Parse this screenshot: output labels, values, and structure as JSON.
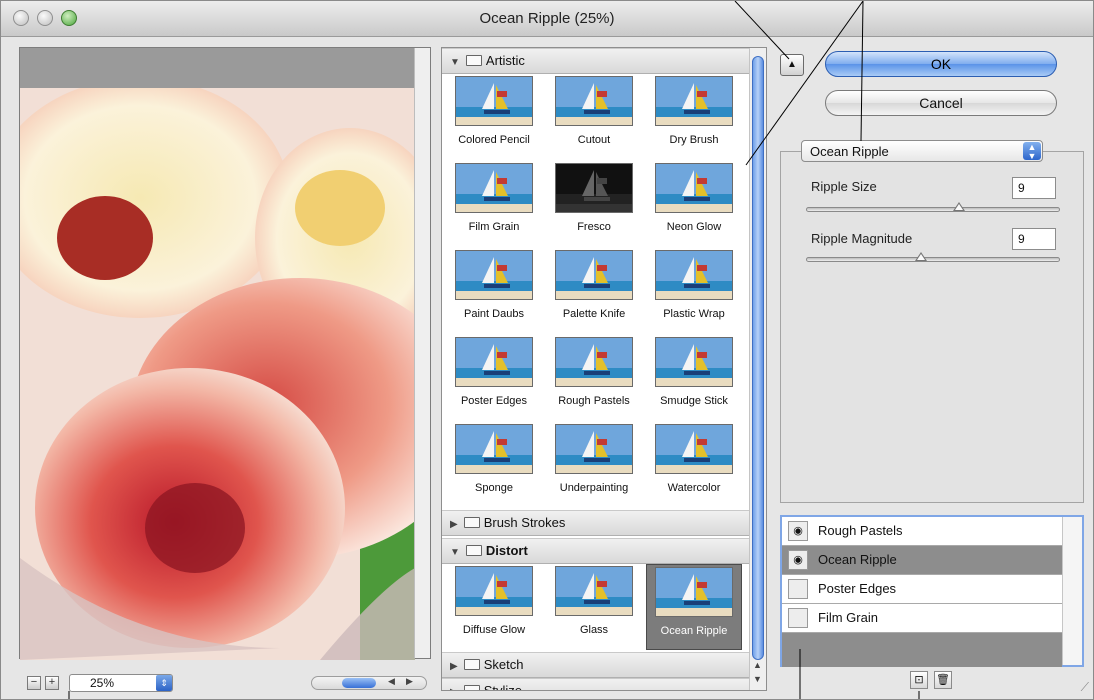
{
  "window": {
    "title": "Ocean Ripple (25%)"
  },
  "preview": {
    "zoom_value": "25%",
    "zoom_out_symbol": "−",
    "zoom_in_symbol": "+"
  },
  "gallery": {
    "categories": [
      {
        "name": "Artistic",
        "expanded": true,
        "filters": [
          "Colored Pencil",
          "Cutout",
          "Dry Brush",
          "Film Grain",
          "Fresco",
          "Neon Glow",
          "Paint Daubs",
          "Palette Knife",
          "Plastic Wrap",
          "Poster Edges",
          "Rough Pastels",
          "Smudge Stick",
          "Sponge",
          "Underpainting",
          "Watercolor"
        ]
      },
      {
        "name": "Brush Strokes",
        "expanded": false
      },
      {
        "name": "Distort",
        "expanded": true,
        "filters": [
          "Diffuse Glow",
          "Glass",
          "Ocean Ripple"
        ],
        "selected": "Ocean Ripple"
      },
      {
        "name": "Sketch",
        "expanded": false
      },
      {
        "name": "Stylize",
        "expanded": false
      }
    ]
  },
  "buttons": {
    "ok": "OK",
    "cancel": "Cancel",
    "collapse_icon": "▲"
  },
  "settings": {
    "selected_filter": "Ocean Ripple",
    "params": [
      {
        "label": "Ripple Size",
        "value": "9",
        "level": 0.6
      },
      {
        "label": "Ripple Magnitude",
        "value": "9",
        "level": 0.45
      }
    ]
  },
  "layers": {
    "items": [
      {
        "name": "Rough Pastels",
        "visible": true,
        "selected": false
      },
      {
        "name": "Ocean Ripple",
        "visible": true,
        "selected": true
      },
      {
        "name": "Poster Edges",
        "visible": false,
        "selected": false
      },
      {
        "name": "Film Grain",
        "visible": false,
        "selected": false
      }
    ]
  },
  "icons": {
    "eye": "eye-icon",
    "new_layer": "new-effect-layer-icon",
    "trash": "trash-icon",
    "folder": "folder-icon"
  },
  "colors": {
    "accent": "#5b93e8",
    "selected_row": "#8d8d8d"
  }
}
